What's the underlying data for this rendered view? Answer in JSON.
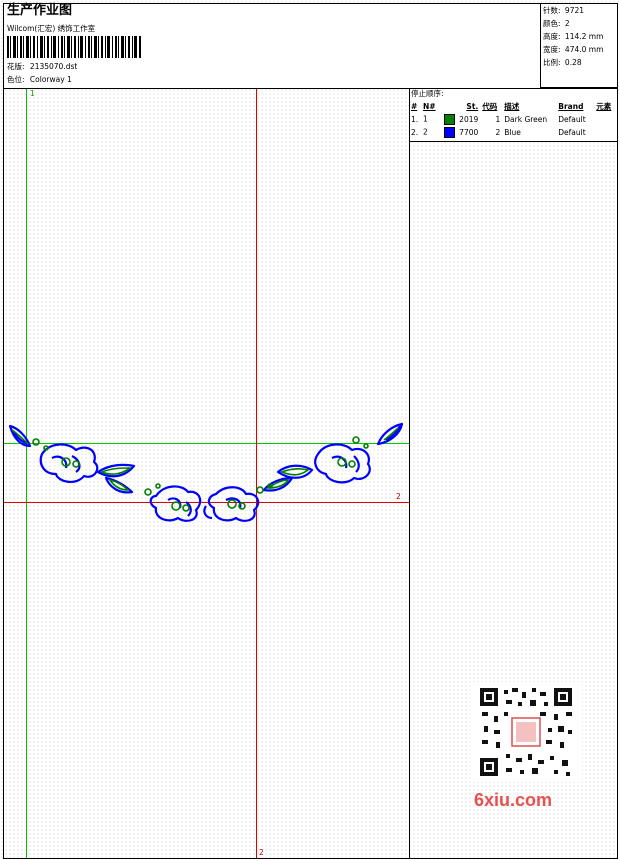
{
  "header": {
    "title": "生产作业图",
    "company": "Wilcom(汇宏) 绣饰工作室",
    "design_label": "花版:",
    "design_value": "2135070.dst",
    "colorway_label": "色位:",
    "colorway_value": "Colorway 1"
  },
  "specs": {
    "stitches_label": "针数:",
    "stitches_value": "9721",
    "colors_label": "颜色:",
    "colors_value": "2",
    "height_label": "高度:",
    "height_value": "114.2 mm",
    "width_label": "宽度:",
    "width_value": "474.0 mm",
    "scale_label": "比例:",
    "scale_value": "0.28"
  },
  "color_table": {
    "title": "停止顺序:",
    "headers": [
      "#",
      "N#",
      "St.",
      "代码",
      "描述",
      "Brand",
      "元素"
    ],
    "rows": [
      {
        "idx": "1.",
        "n": "1",
        "color": "#008000",
        "code": "2019",
        "st": "1",
        "desc": "Dark Green",
        "brand": "Default"
      },
      {
        "idx": "2.",
        "n": "2",
        "color": "#0000ff",
        "code": "7700",
        "st": "2",
        "desc": "Blue",
        "brand": "Default"
      }
    ]
  },
  "markers": {
    "green_label": "1",
    "red_right_label": "2",
    "red_bottom_label": "2"
  },
  "watermark": {
    "text": "6xiu.com"
  },
  "palette": {
    "green_thread": "#008000",
    "blue_thread": "#0000ff",
    "guide_green": "#00c800",
    "guide_red": "#e00000"
  }
}
